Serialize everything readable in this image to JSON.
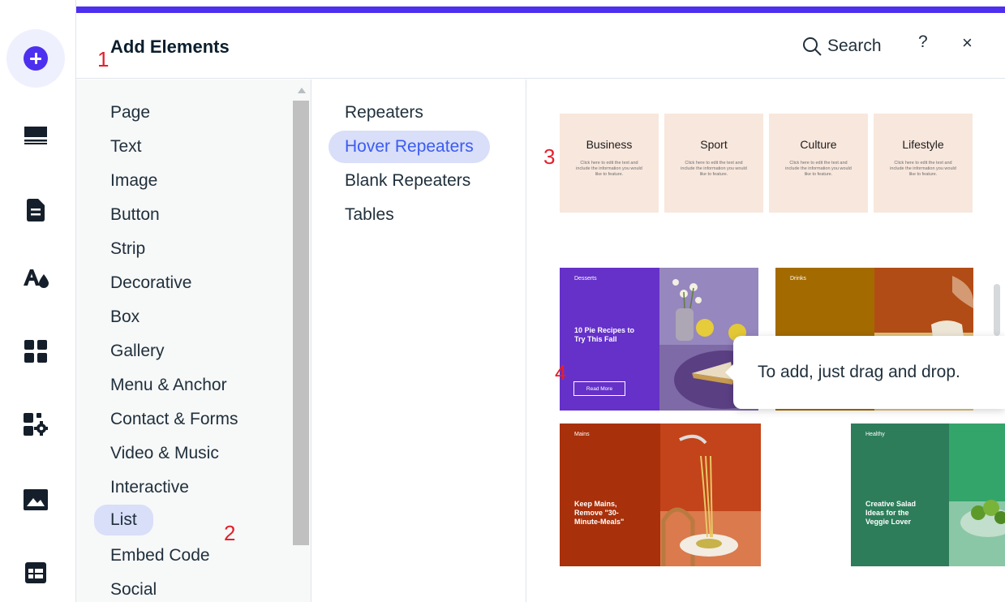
{
  "rail": {
    "icons": [
      "add-icon",
      "sections-icon",
      "pages-icon",
      "theme-icon",
      "apps-icon",
      "business-icon",
      "media-icon",
      "table-icon"
    ]
  },
  "panel": {
    "title": "Add Elements",
    "search_label": "Search",
    "help_label": "?",
    "close_label": "×",
    "accent_color": "#4d2ff0"
  },
  "categories": [
    "Page",
    "Text",
    "Image",
    "Button",
    "Strip",
    "Decorative",
    "Box",
    "Gallery",
    "Menu & Anchor",
    "Contact & Forms",
    "Video & Music",
    "Interactive",
    "List",
    "Embed Code",
    "Social"
  ],
  "selected_category": "List",
  "subcategories": [
    "Repeaters",
    "Hover Repeaters",
    "Blank Repeaters",
    "Tables"
  ],
  "selected_subcategory": "Hover Repeaters",
  "preview": {
    "light_cards": [
      {
        "title": "Business",
        "desc": "Click here to edit the text and include the information you would like to feature."
      },
      {
        "title": "Sport",
        "desc": "Click here to edit the text and include the information you would like to feature."
      },
      {
        "title": "Culture",
        "desc": "Click here to edit the text and include the information you would like to feature."
      },
      {
        "title": "Lifestyle",
        "desc": "Click here to edit the text and include the information you would like to feature."
      }
    ],
    "tiles": [
      {
        "tag": "Desserts",
        "headline": "10 Pie Recipes to Try This Fall",
        "button": "Read More",
        "color": "#6531c9"
      },
      {
        "tag": "Drinks",
        "headline": "",
        "button": "",
        "color": "#a36a00"
      },
      {
        "tag": "Mains",
        "headline": "Keep Mains, Remove \"30-Minute-Meals\"",
        "button": "",
        "color": "#a8300a"
      },
      {
        "tag": "Healthy",
        "headline": "Creative Salad Ideas for the Veggie Lover",
        "button": "",
        "color": "#2d7d5a"
      }
    ]
  },
  "tooltip": "To add, just drag and drop.",
  "markers": [
    "1",
    "2",
    "3",
    "4"
  ]
}
